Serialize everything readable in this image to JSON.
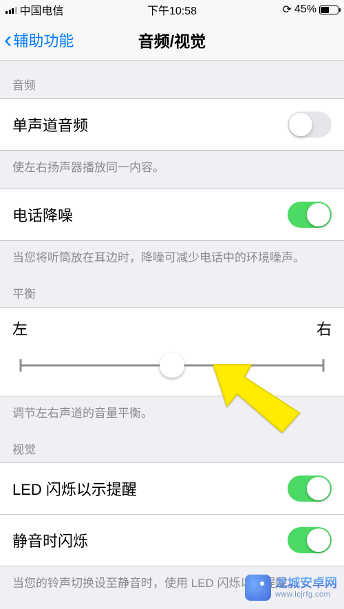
{
  "status": {
    "carrier": "中国电信",
    "time": "下午10:58",
    "battery_percent": "45%"
  },
  "nav": {
    "back_label": "辅助功能",
    "title": "音频/视觉"
  },
  "audio": {
    "header": "音频",
    "mono": {
      "label": "单声道音频",
      "on": false
    },
    "mono_footer": "使左右扬声器播放同一内容。",
    "noise": {
      "label": "电话降噪",
      "on": true
    },
    "noise_footer": "当您将听筒放在耳边时，降噪可减少电话中的环境噪声。"
  },
  "balance": {
    "header": "平衡",
    "left_label": "左",
    "right_label": "右",
    "value": 0.5,
    "footer": "调节左右声道的音量平衡。"
  },
  "visual": {
    "header": "视觉",
    "led": {
      "label": "LED 闪烁以示提醒",
      "on": true
    },
    "silent": {
      "label": "静音时闪烁",
      "on": true
    },
    "footer": "当您的铃声切换设至静音时，使用 LED 闪烁以示提醒。"
  },
  "watermark": {
    "title": "龙城安卓网",
    "url": "www.lcjrfg.com"
  }
}
